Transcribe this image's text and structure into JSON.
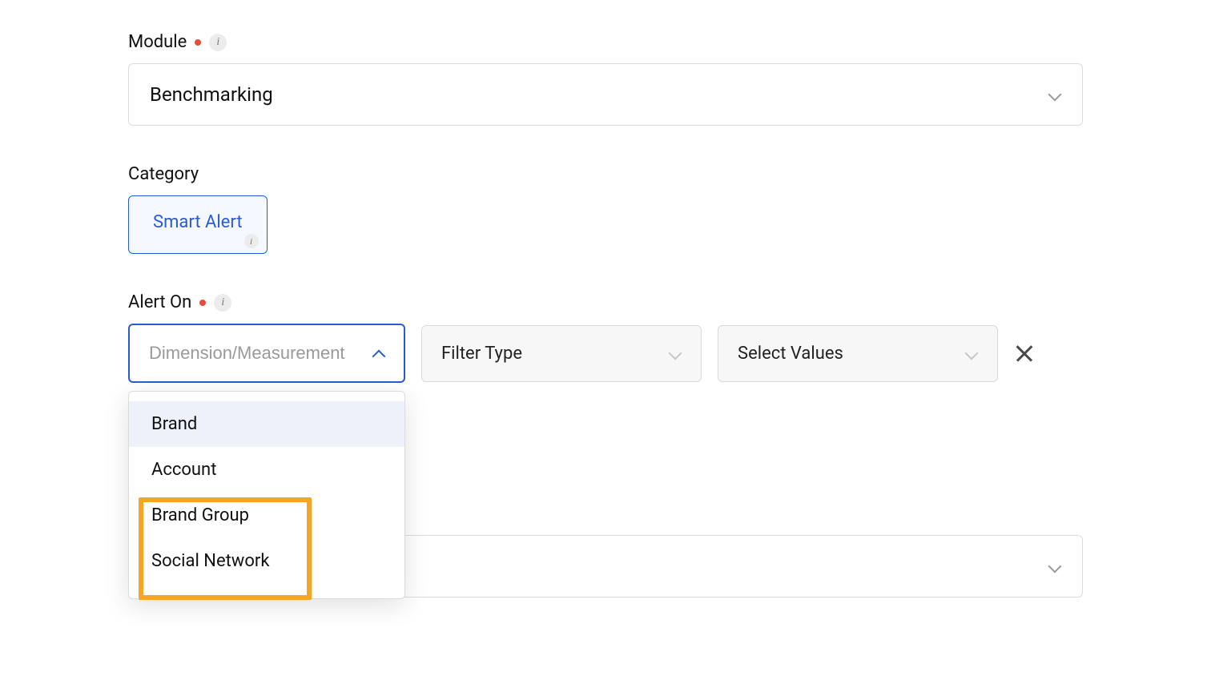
{
  "module": {
    "label": "Module",
    "value": "Benchmarking",
    "required": true
  },
  "category": {
    "label": "Category",
    "chip_label": "Smart Alert"
  },
  "alert_on": {
    "label": "Alert On",
    "required": true,
    "dimension_placeholder": "Dimension/Measurement",
    "filter_type_label": "Filter Type",
    "select_values_label": "Select Values",
    "options": [
      {
        "label": "Brand",
        "highlighted": true
      },
      {
        "label": "Account",
        "highlighted": false
      },
      {
        "label": "Brand Group",
        "highlighted": false
      },
      {
        "label": "Social Network",
        "highlighted": false
      }
    ]
  }
}
